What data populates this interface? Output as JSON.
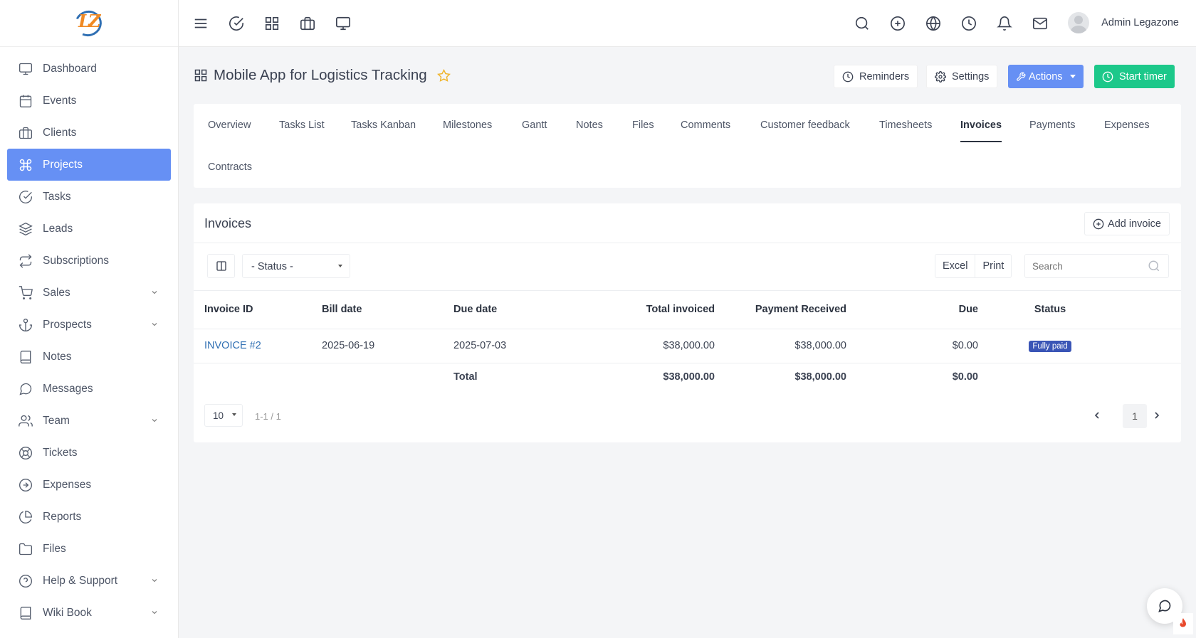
{
  "sidebar": {
    "logo_text": "LZ",
    "items": [
      {
        "label": "Dashboard"
      },
      {
        "label": "Events"
      },
      {
        "label": "Clients"
      },
      {
        "label": "Projects"
      },
      {
        "label": "Tasks"
      },
      {
        "label": "Leads"
      },
      {
        "label": "Subscriptions"
      },
      {
        "label": "Sales"
      },
      {
        "label": "Prospects"
      },
      {
        "label": "Notes"
      },
      {
        "label": "Messages"
      },
      {
        "label": "Team"
      },
      {
        "label": "Tickets"
      },
      {
        "label": "Expenses"
      },
      {
        "label": "Reports"
      },
      {
        "label": "Files"
      },
      {
        "label": "Help & Support"
      },
      {
        "label": "Wiki Book"
      }
    ],
    "active": "Projects"
  },
  "topbar": {
    "left_icons": [
      "menu-icon",
      "check-circle-icon",
      "grid-icon",
      "briefcase-icon",
      "monitor-icon"
    ],
    "right_icons": [
      "search-icon",
      "plus-circle-icon",
      "globe-icon",
      "clock-icon",
      "bell-icon",
      "mail-icon"
    ],
    "user_name": "Admin Legazone"
  },
  "header": {
    "title": "Mobile App for Logistics Tracking",
    "reminders_label": "Reminders",
    "settings_label": "Settings",
    "actions_label": "Actions",
    "start_timer_label": "Start timer"
  },
  "tabs": [
    {
      "label": "Overview"
    },
    {
      "label": "Tasks List"
    },
    {
      "label": "Tasks Kanban"
    },
    {
      "label": "Milestones"
    },
    {
      "label": "Gantt"
    },
    {
      "label": "Notes"
    },
    {
      "label": "Files"
    },
    {
      "label": "Comments"
    },
    {
      "label": "Customer feedback"
    },
    {
      "label": "Timesheets"
    },
    {
      "label": "Invoices"
    },
    {
      "label": "Payments"
    },
    {
      "label": "Expenses"
    },
    {
      "label": "Contracts"
    }
  ],
  "active_tab": "Invoices",
  "invoices": {
    "title": "Invoices",
    "add_label": "Add invoice",
    "status_filter": "- Status -",
    "excel_label": "Excel",
    "print_label": "Print",
    "search_placeholder": "Search",
    "columns": [
      "Invoice ID",
      "Bill date",
      "Due date",
      "Total invoiced",
      "Payment Received",
      "Due",
      "Status"
    ],
    "rows": [
      {
        "id": "INVOICE #2",
        "bill_date": "2025-06-19",
        "due_date": "2025-07-03",
        "total": "$38,000.00",
        "received": "$38,000.00",
        "due": "$0.00",
        "status": "Fully paid"
      }
    ],
    "totals": {
      "label": "Total",
      "total": "$38,000.00",
      "received": "$38,000.00",
      "due": "$0.00"
    },
    "page_size": "10",
    "page_info": "1-1 / 1",
    "current_page": "1"
  },
  "colors": {
    "accent": "#6690f4",
    "success": "#1cc88a",
    "badge": "#3a55b6",
    "link": "#2f6fb3"
  }
}
